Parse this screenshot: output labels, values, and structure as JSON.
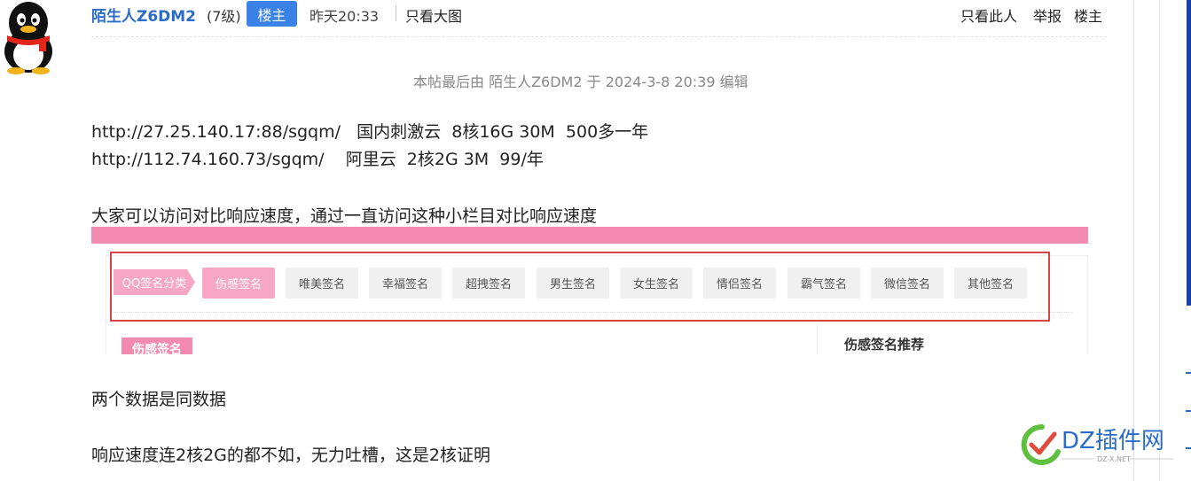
{
  "post": {
    "author": "陌生人Z6DM2",
    "level": "(7级)",
    "owner_badge": "楼主",
    "time": "昨天20:33",
    "view_big_image": "只看大图",
    "actions": [
      "只看此人",
      "举报",
      "楼主"
    ],
    "edited_note": "本帖最后由 陌生人Z6DM2 于 2024-3-8 20:39 编辑",
    "lines": [
      "http://27.25.140.17:88/sgqm/   国内刺激云  8核16G 30M  500多一年",
      "http://112.74.160.73/sgqm/    阿里云  2核2G 3M  99/年",
      "大家可以访问对比响应速度，通过一直访问这种小栏目对比响应速度",
      "两个数据是同数据",
      "响应速度连2核2G的都不如，无力吐槽，这是2核证明"
    ]
  },
  "screenshot": {
    "category_label": "QQ签名分类",
    "tags": [
      "伤感签名",
      "唯美签名",
      "幸福签名",
      "超拽签名",
      "男生签名",
      "女生签名",
      "情侣签名",
      "霸气签名",
      "微信签名",
      "其他签名"
    ],
    "active_tag": "伤感签名",
    "section_title": "伤感签名",
    "recommend_title": "伤感签名推荐"
  },
  "watermark": {
    "brand": "DZ插件网",
    "sub": "DZ-X.NET"
  },
  "colors": {
    "link_blue": "#2a6cc9",
    "badge_blue": "#3b82e6",
    "pink": "#f38bb0",
    "pink_light": "#f7a6c3",
    "red_box": "#d64545"
  }
}
